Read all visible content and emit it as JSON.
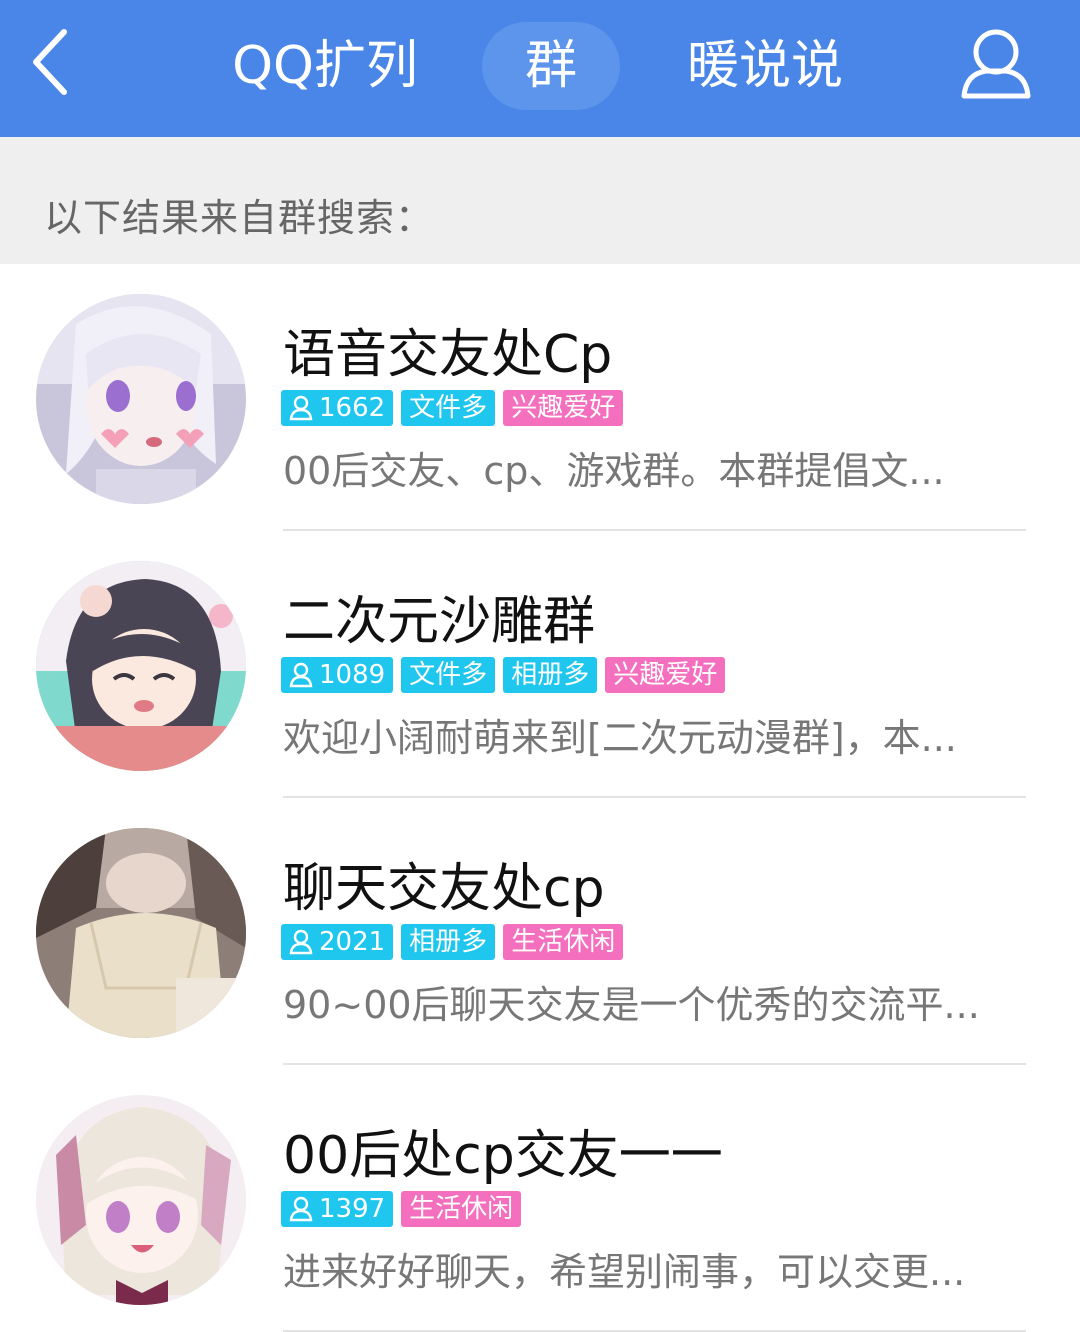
{
  "header": {
    "tabs": [
      {
        "label": "QQ扩列"
      },
      {
        "label": "群"
      },
      {
        "label": "暖说说"
      }
    ],
    "icons": {
      "back": "chevron-left-icon",
      "profile": "user-icon"
    },
    "colors": {
      "bar": "#4a86e8",
      "active_tab": "#5d95ec"
    }
  },
  "subheader": {
    "text": "以下结果来自群搜索："
  },
  "groups": [
    {
      "name": "语音交友处Cp",
      "members": "1662",
      "tags": [
        "文件多"
      ],
      "category": "兴趣爱好",
      "description": "00后交友、cp、游戏群。本群提倡文..."
    },
    {
      "name": "二次元沙雕群",
      "members": "1089",
      "tags": [
        "文件多",
        "相册多"
      ],
      "category": "兴趣爱好",
      "description": "欢迎小阔耐萌来到[二次元动漫群]，本..."
    },
    {
      "name": "聊天交友处cp",
      "members": "2021",
      "tags": [
        "相册多"
      ],
      "category": "生活休闲",
      "description": "90~00后聊天交友是一个优秀的交流平..."
    },
    {
      "name": "00后处cp交友一一",
      "members": "1397",
      "tags": [],
      "category": "生活休闲",
      "description": "进来好好聊天，希望别闹事，可以交更..."
    }
  ]
}
